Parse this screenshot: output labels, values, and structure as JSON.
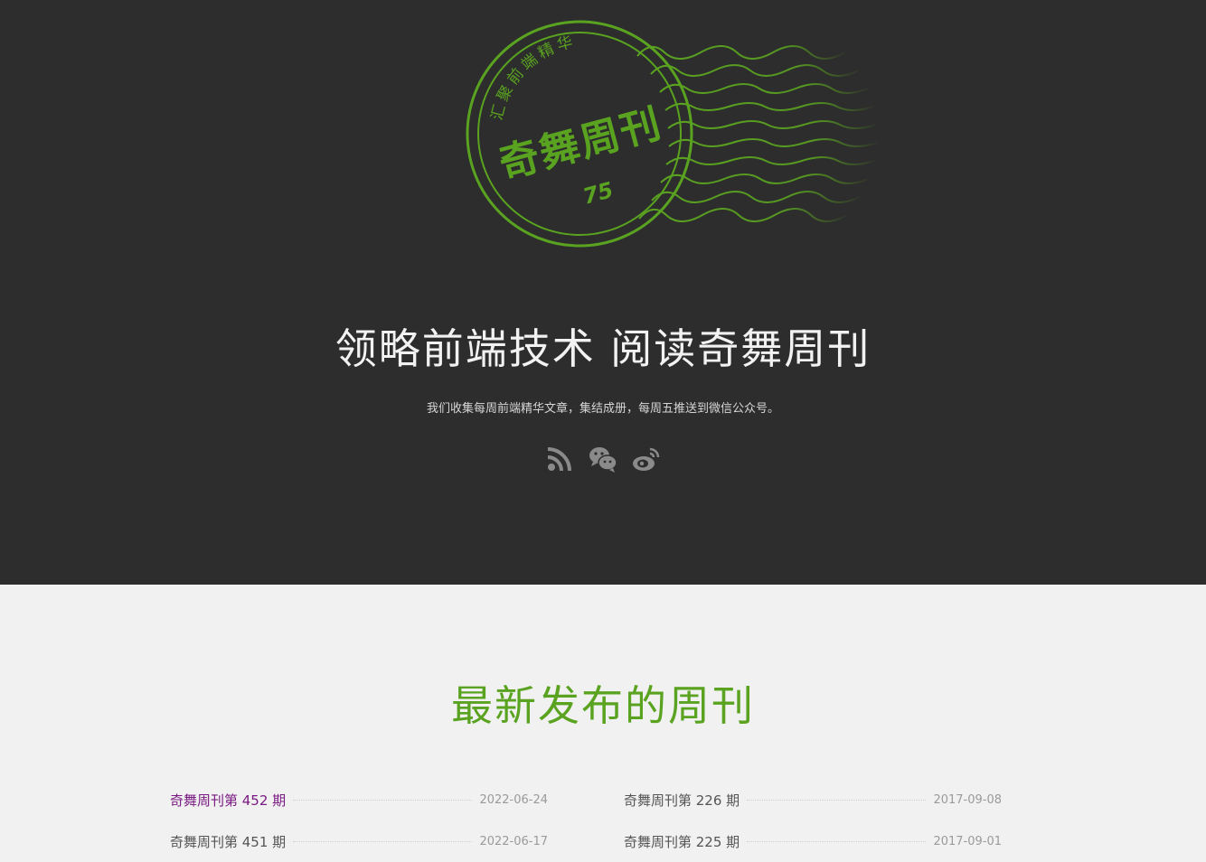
{
  "brand": {
    "stamp_arc_text": "汇聚前端精华",
    "stamp_name": "奇舞周刊",
    "stamp_number": "75",
    "accent_color": "#5aa320"
  },
  "hero": {
    "title": "领略前端技术 阅读奇舞周刊",
    "subtitle": "我们收集每周前端精华文章，集结成册，每周五推送到微信公众号。",
    "social_icons": [
      "rss-icon",
      "wechat-icon",
      "weibo-icon"
    ]
  },
  "latest": {
    "title": "最新发布的周刊",
    "left_column": [
      {
        "name": "奇舞周刊第 452 期",
        "date": "2022-06-24"
      },
      {
        "name": "奇舞周刊第 451 期",
        "date": "2022-06-17"
      }
    ],
    "right_column": [
      {
        "name": "奇舞周刊第 226 期",
        "date": "2017-09-08"
      },
      {
        "name": "奇舞周刊第 225 期",
        "date": "2017-09-01"
      }
    ]
  }
}
